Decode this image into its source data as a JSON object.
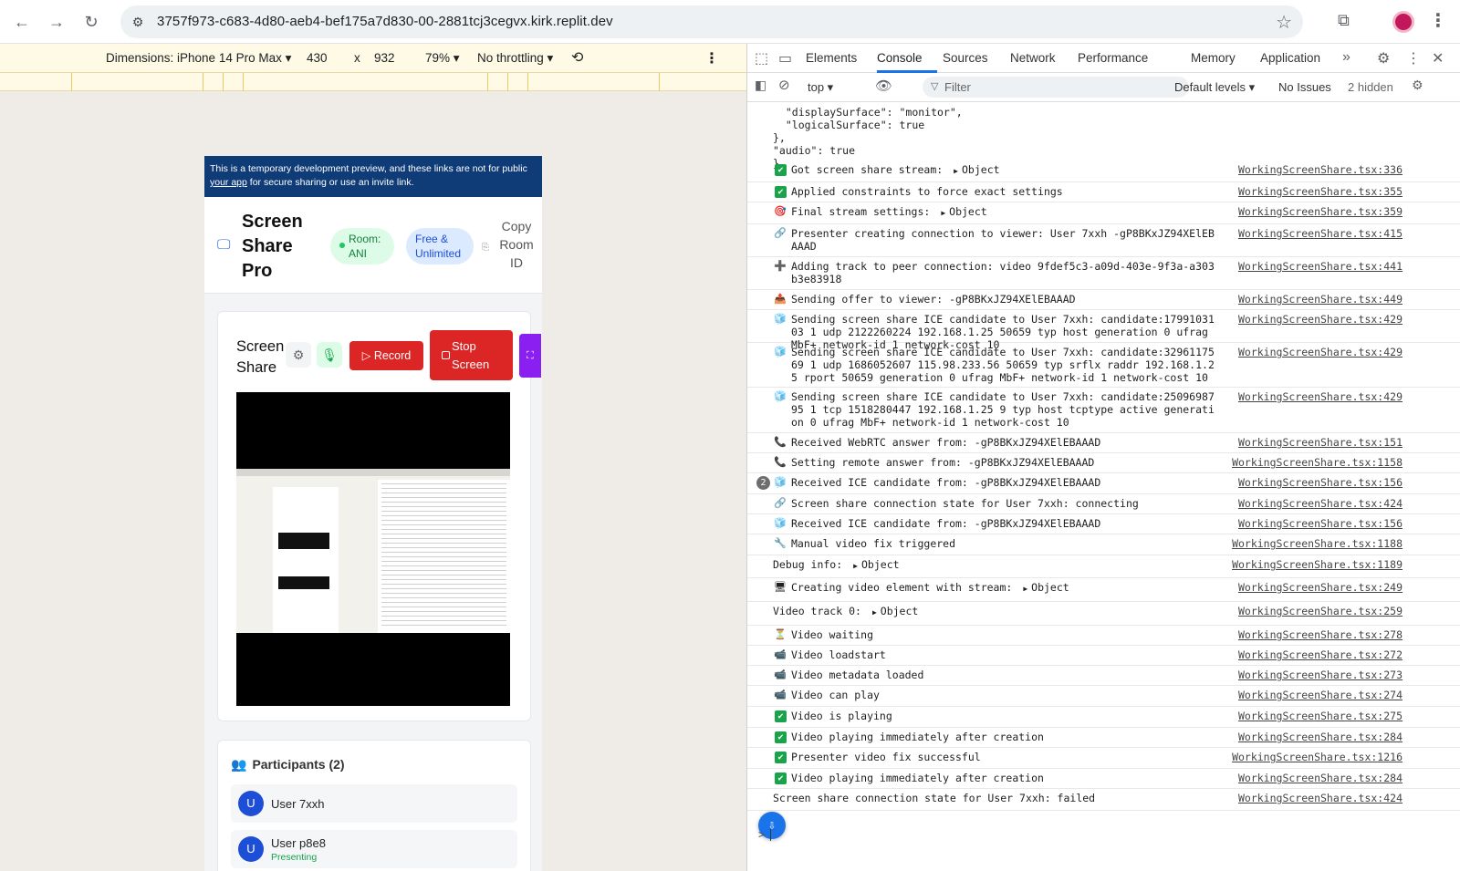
{
  "browser": {
    "url": "3757f973-c683-4d80-aeb4-bef175a7d830-00-2881tcj3cegvx.kirk.replit.dev",
    "back_icon": "←",
    "forward_icon": "→",
    "reload_icon": "↻",
    "star_icon": "☆"
  },
  "device_toolbar": {
    "dimensions": "Dimensions: iPhone 14 Pro Max ▾",
    "width": "430",
    "x": "x",
    "height": "932",
    "zoom": "79% ▾",
    "throttle": "No throttling ▾"
  },
  "app": {
    "banner_text": "This is a temporary development preview, and these links are not for public",
    "banner_link": "your app",
    "banner_rest": " for secure sharing or use an invite link.",
    "title": "Screen Share Pro",
    "room_badge": "Room: ANI",
    "plan_badge": "Free & Unlimited",
    "copy_button": "Copy Room ID",
    "share_title": "Screen Share",
    "record_button": "Record",
    "stop_button": "Stop Screen",
    "participants_title": "Participants (2)",
    "participants": [
      {
        "initial": "U",
        "name": "User 7xxh",
        "status": ""
      },
      {
        "initial": "U",
        "name": "User p8e8",
        "status": "Presenting"
      }
    ]
  },
  "devtools": {
    "tabs": [
      "Elements",
      "Console",
      "Sources",
      "Network",
      "Performance",
      "Memory",
      "Application"
    ],
    "active_tab": "Console",
    "context": "top ▾",
    "filter_placeholder": "Filter",
    "levels": "Default levels ▾",
    "issues": "No Issues",
    "hidden": "2 hidden",
    "pre_lines": "  \"displaySurface\": \"monitor\",\n  \"logicalSurface\": true\n},\n\"audio\": true\n}",
    "logs": [
      {
        "icon": "✔",
        "msg": "Got screen share stream:",
        "obj": "Object",
        "src": "WorkingScreenShare.tsx:336"
      },
      {
        "icon": "✔",
        "msg": "Applied constraints to force exact settings",
        "src": "WorkingScreenShare.tsx:355"
      },
      {
        "icon": "🎯",
        "msg": "Final stream settings:",
        "obj": "Object",
        "src": "WorkingScreenShare.tsx:359"
      },
      {
        "icon": "🔗",
        "msg": "Presenter creating connection to viewer: User 7xxh -gP8BKxJZ94XElEBAAAD",
        "src": "WorkingScreenShare.tsx:415"
      },
      {
        "icon": "➕",
        "msg": "Adding track to peer connection: video 9fdef5c3-a09d-403e-9f3a-a303b3e83918",
        "src": "WorkingScreenShare.tsx:441"
      },
      {
        "icon": "📤",
        "msg": "Sending offer to viewer: -gP8BKxJZ94XElEBAAAD",
        "src": "WorkingScreenShare.tsx:449"
      },
      {
        "icon": "🧊",
        "msg": "Sending screen share ICE candidate to User 7xxh: candidate:1799103103 1 udp 2122260224 192.168.1.25 50659 typ host generation 0 ufrag MbF+ network-id 1 network-cost 10",
        "src": "WorkingScreenShare.tsx:429"
      },
      {
        "icon": "🧊",
        "msg": "Sending screen share ICE candidate to User 7xxh: candidate:3296117569 1 udp 1686052607 115.98.233.56 50659 typ srflx raddr 192.168.1.25 rport 50659 generation 0 ufrag MbF+ network-id 1 network-cost 10",
        "src": "WorkingScreenShare.tsx:429"
      },
      {
        "icon": "🧊",
        "msg": "Sending screen share ICE candidate to User 7xxh: candidate:2509698795 1 tcp 1518280447 192.168.1.25 9 typ host tcptype active generation 0 ufrag MbF+ network-id 1 network-cost 10",
        "src": "WorkingScreenShare.tsx:429"
      },
      {
        "icon": "📞",
        "msg": "Received WebRTC answer from: -gP8BKxJZ94XElEBAAAD",
        "src": "WorkingScreenShare.tsx:151"
      },
      {
        "icon": "📞",
        "msg": "Setting remote answer from: -gP8BKxJZ94XElEBAAAD",
        "src": "WorkingScreenShare.tsx:1158"
      },
      {
        "icon": "🧊",
        "msg": "Received ICE candidate from: -gP8BKxJZ94XElEBAAAD",
        "src": "WorkingScreenShare.tsx:156",
        "count": "2"
      },
      {
        "icon": "🔗",
        "msg": "Screen share connection state for User 7xxh: connecting",
        "src": "WorkingScreenShare.tsx:424"
      },
      {
        "icon": "🧊",
        "msg": "Received ICE candidate from: -gP8BKxJZ94XElEBAAAD",
        "src": "WorkingScreenShare.tsx:156"
      },
      {
        "icon": "🔧",
        "msg": "Manual video fix triggered",
        "src": "WorkingScreenShare.tsx:1188"
      },
      {
        "icon": "",
        "msg": "Debug info:",
        "obj": "Object",
        "src": "WorkingScreenShare.tsx:1189"
      },
      {
        "icon": "🖥",
        "msg": "Creating video element with stream:",
        "obj": "Object",
        "src": "WorkingScreenShare.tsx:249"
      },
      {
        "icon": "",
        "msg": "Video track 0:",
        "obj": "Object",
        "src": "WorkingScreenShare.tsx:259"
      },
      {
        "icon": "⏳",
        "msg": "Video waiting",
        "src": "WorkingScreenShare.tsx:278"
      },
      {
        "icon": "📹",
        "msg": "Video loadstart",
        "src": "WorkingScreenShare.tsx:272"
      },
      {
        "icon": "📹",
        "msg": "Video metadata loaded",
        "src": "WorkingScreenShare.tsx:273"
      },
      {
        "icon": "📹",
        "msg": "Video can play",
        "src": "WorkingScreenShare.tsx:274"
      },
      {
        "icon": "✔",
        "msg": "Video is playing",
        "src": "WorkingScreenShare.tsx:275"
      },
      {
        "icon": "✔",
        "msg": "Video playing immediately after creation",
        "src": "WorkingScreenShare.tsx:284"
      },
      {
        "icon": "✔",
        "msg": "Presenter video fix successful",
        "src": "WorkingScreenShare.tsx:1216"
      },
      {
        "icon": "✔",
        "msg": "Video playing immediately after creation",
        "src": "WorkingScreenShare.tsx:284"
      },
      {
        "icon": "",
        "msg": "Screen share connection state for User 7xxh: failed",
        "src": "WorkingScreenShare.tsx:424"
      }
    ],
    "prompt": ">"
  },
  "colors": {
    "accent": "#1a73e8",
    "danger": "#dc2626",
    "success": "#16a34a",
    "banner": "#0f3b77",
    "purple": "#8b1ef0"
  }
}
